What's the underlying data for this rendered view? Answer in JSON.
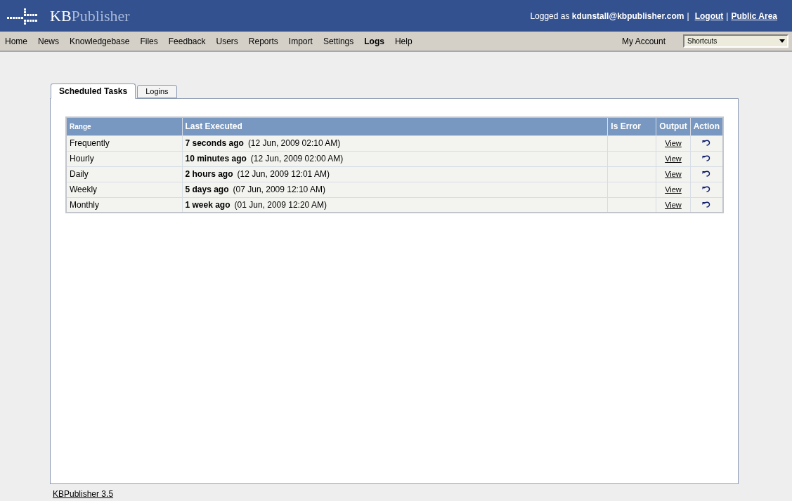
{
  "header": {
    "logo": {
      "part_1": "KB",
      "part_2": "Publisher"
    },
    "login_text": "Logged as **kdunstall@kbpublisher.com**",
    "separator_1": "|",
    "logout_link": "Logout",
    "separator_2": "|",
    "public_area_link": "Public Area"
  },
  "menu": {
    "items": [
      {
        "label": "Home",
        "selected": false
      },
      {
        "label": "News",
        "selected": false
      },
      {
        "label": "Knowledgebase",
        "selected": false
      },
      {
        "label": "Files",
        "selected": false
      },
      {
        "label": "Feedback",
        "selected": false
      },
      {
        "label": "Users",
        "selected": false
      },
      {
        "label": "Reports",
        "selected": false
      },
      {
        "label": "Import",
        "selected": false
      },
      {
        "label": "Settings",
        "selected": false
      },
      {
        "label": "Logs",
        "selected": true
      },
      {
        "label": "Help",
        "selected": false
      }
    ],
    "my_account": "My Account",
    "shortcuts": {
      "value": "Shortcuts"
    }
  },
  "tabs": [
    {
      "label": "Scheduled Tasks",
      "selected": true
    },
    {
      "label": "Logins",
      "selected": false
    }
  ],
  "table": {
    "columns": [
      "Range",
      "Last Executed",
      "Is Error",
      "Output",
      "Action"
    ],
    "rows": [
      {
        "range": "Frequently",
        "ago": "7 seconds ago",
        "date": "(12 Jun, 2009 02:10 AM)",
        "output": "View"
      },
      {
        "range": "Hourly",
        "ago": "10 minutes ago",
        "date": "(12 Jun, 2009 02:00 AM)",
        "output": "View"
      },
      {
        "range": "Daily",
        "ago": "2 hours ago",
        "date": "(12 Jun, 2009 12:01 AM)",
        "output": "View"
      },
      {
        "range": "Weekly",
        "ago": "5 days ago",
        "date": "(07 Jun, 2009 12:10 AM)",
        "output": "View"
      },
      {
        "range": "Monthly",
        "ago": "1 week ago",
        "date": "(01 Jun, 2009 12:20 AM)",
        "output": "View"
      }
    ]
  },
  "footer": {
    "version_link": "KBPublisher 3.5"
  }
}
